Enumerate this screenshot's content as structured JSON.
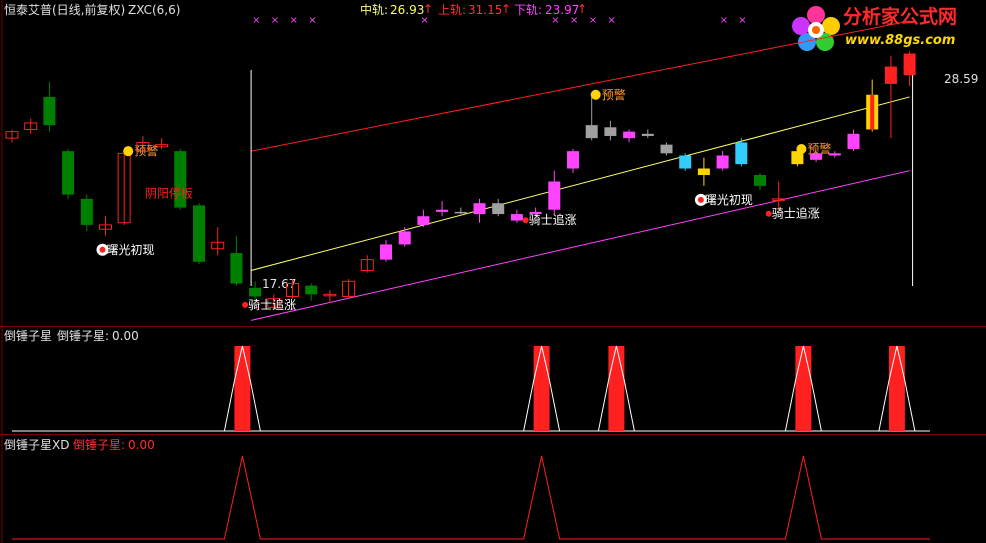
{
  "header": {
    "title": "恒泰艾普(日线,前复权)",
    "indicator": "ZXC(6,6)",
    "mid_label": "中轨:",
    "mid_value": "26.93",
    "upper_label": "上轨:",
    "upper_value": "31.15",
    "lower_label": "下轨:",
    "lower_value": "23.97",
    "arrow": "↑"
  },
  "logo": {
    "name": "分析家公式网",
    "url": "www.88gs.com"
  },
  "colors": {
    "background": "#000000",
    "red": "#ff2020",
    "pink": "#ff44ff",
    "yellow": "#ffff66",
    "green": "#008000",
    "gray": "#a0a0a0",
    "cyan": "#33ccff",
    "gold": "#ffd400",
    "separator": "#7a0000",
    "orange_text": "#ff9933"
  },
  "signals": {
    "warn": "预警",
    "dawn": "曙光初现",
    "knight": "骑士追涨",
    "yinyang": "阴阳停板"
  },
  "price_labels": {
    "high": "28.59",
    "low": "17.67"
  },
  "panel2": {
    "name": "倒锤子星",
    "name2": "倒锤子星:",
    "value": "0.00"
  },
  "panel3": {
    "name": "倒锤子星XD",
    "name2": "倒锤子星:",
    "value": "0.00"
  },
  "chart_data": {
    "type": "candlestick",
    "price_range": [
      17.0,
      30.0
    ],
    "candles": [
      {
        "o": 24.9,
        "c": 24.6,
        "h": 25.0,
        "l": 24.4,
        "color": "red_hollow"
      },
      {
        "o": 25.0,
        "c": 25.3,
        "h": 25.5,
        "l": 24.8,
        "color": "red_hollow"
      },
      {
        "o": 26.5,
        "c": 25.2,
        "h": 27.2,
        "l": 24.9,
        "color": "green"
      },
      {
        "o": 24.0,
        "c": 22.0,
        "h": 24.1,
        "l": 21.8,
        "color": "green"
      },
      {
        "o": 21.8,
        "c": 20.6,
        "h": 22.0,
        "l": 20.3,
        "color": "green"
      },
      {
        "o": 20.6,
        "c": 20.4,
        "h": 21.0,
        "l": 20.1,
        "color": "red_hollow"
      },
      {
        "o": 20.7,
        "c": 23.9,
        "h": 24.0,
        "l": 20.6,
        "color": "red_hollow"
      },
      {
        "o": 24.0,
        "c": 24.4,
        "h": 24.7,
        "l": 23.9,
        "color": "red_hollow"
      },
      {
        "o": 24.2,
        "c": 24.3,
        "h": 24.6,
        "l": 24.1,
        "color": "red_hollow"
      },
      {
        "o": 24.0,
        "c": 21.4,
        "h": 24.1,
        "l": 21.3,
        "color": "green"
      },
      {
        "o": 21.5,
        "c": 18.9,
        "h": 21.6,
        "l": 18.8,
        "color": "green"
      },
      {
        "o": 19.5,
        "c": 19.8,
        "h": 20.5,
        "l": 19.2,
        "color": "red_hollow"
      },
      {
        "o": 19.3,
        "c": 17.9,
        "h": 20.1,
        "l": 17.8,
        "color": "green"
      },
      {
        "o": 17.7,
        "c": 17.3,
        "h": 18.0,
        "l": 17.1,
        "color": "green"
      },
      {
        "o": 16.8,
        "c": 17.2,
        "h": 17.4,
        "l": 16.7,
        "color": "red_hollow"
      },
      {
        "o": 17.3,
        "c": 17.9,
        "h": 18.1,
        "l": 17.2,
        "color": "red_hollow"
      },
      {
        "o": 17.8,
        "c": 17.4,
        "h": 17.9,
        "l": 17.1,
        "color": "green"
      },
      {
        "o": 17.4,
        "c": 17.4,
        "h": 17.6,
        "l": 17.0,
        "color": "red_hollow"
      },
      {
        "o": 17.3,
        "c": 18.0,
        "h": 18.1,
        "l": 17.2,
        "color": "red_hollow"
      },
      {
        "o": 18.5,
        "c": 19.0,
        "h": 19.2,
        "l": 18.4,
        "color": "red_hollow"
      },
      {
        "o": 19.0,
        "c": 19.7,
        "h": 19.9,
        "l": 18.9,
        "color": "pink"
      },
      {
        "o": 19.7,
        "c": 20.3,
        "h": 20.5,
        "l": 19.6,
        "color": "pink"
      },
      {
        "o": 20.6,
        "c": 21.0,
        "h": 21.3,
        "l": 20.5,
        "color": "pink"
      },
      {
        "o": 21.2,
        "c": 21.3,
        "h": 21.7,
        "l": 21.0,
        "color": "pink"
      },
      {
        "o": 21.2,
        "c": 21.2,
        "h": 21.4,
        "l": 21.1,
        "color": "gray"
      },
      {
        "o": 21.1,
        "c": 21.6,
        "h": 21.8,
        "l": 20.7,
        "color": "pink"
      },
      {
        "o": 21.6,
        "c": 21.1,
        "h": 21.8,
        "l": 21.0,
        "color": "gray"
      },
      {
        "o": 20.8,
        "c": 21.1,
        "h": 21.3,
        "l": 20.7,
        "color": "pink"
      },
      {
        "o": 21.1,
        "c": 21.2,
        "h": 21.4,
        "l": 21.0,
        "color": "pink"
      },
      {
        "o": 21.3,
        "c": 22.6,
        "h": 23.1,
        "l": 21.1,
        "color": "pink"
      },
      {
        "o": 23.2,
        "c": 24.0,
        "h": 24.1,
        "l": 23.0,
        "color": "pink"
      },
      {
        "o": 24.6,
        "c": 25.2,
        "h": 26.6,
        "l": 24.5,
        "color": "gray"
      },
      {
        "o": 25.1,
        "c": 24.7,
        "h": 25.4,
        "l": 24.5,
        "color": "gray"
      },
      {
        "o": 24.6,
        "c": 24.9,
        "h": 25.0,
        "l": 24.4,
        "color": "pink"
      },
      {
        "o": 24.7,
        "c": 24.8,
        "h": 25.0,
        "l": 24.6,
        "color": "gray"
      },
      {
        "o": 24.3,
        "c": 23.9,
        "h": 24.4,
        "l": 23.8,
        "color": "gray"
      },
      {
        "o": 23.8,
        "c": 23.2,
        "h": 23.9,
        "l": 23.1,
        "color": "cyan"
      },
      {
        "o": 22.9,
        "c": 23.2,
        "h": 23.7,
        "l": 22.4,
        "color": "gold"
      },
      {
        "o": 23.2,
        "c": 23.8,
        "h": 24.0,
        "l": 23.1,
        "color": "pink"
      },
      {
        "o": 23.4,
        "c": 24.4,
        "h": 24.6,
        "l": 23.3,
        "color": "cyan"
      },
      {
        "o": 22.9,
        "c": 22.4,
        "h": 23.0,
        "l": 22.2,
        "color": "green"
      },
      {
        "o": 21.8,
        "c": 21.8,
        "h": 22.6,
        "l": 21.3,
        "color": "red_hollow"
      },
      {
        "o": 23.4,
        "c": 24.0,
        "h": 24.1,
        "l": 23.3,
        "color": "gold"
      },
      {
        "o": 23.6,
        "c": 23.9,
        "h": 24.0,
        "l": 23.5,
        "color": "pink"
      },
      {
        "o": 23.8,
        "c": 23.9,
        "h": 24.0,
        "l": 23.7,
        "color": "pink"
      },
      {
        "o": 24.1,
        "c": 24.8,
        "h": 25.0,
        "l": 24.0,
        "color": "pink"
      },
      {
        "o": 25.0,
        "c": 26.6,
        "h": 27.3,
        "l": 24.9,
        "color": "gold_red"
      },
      {
        "o": 27.1,
        "c": 27.9,
        "h": 28.4,
        "l": 24.6,
        "color": "red"
      },
      {
        "o": 27.5,
        "c": 28.5,
        "h": 28.6,
        "l": 27.0,
        "color": "red"
      }
    ],
    "channel_start_candle": 13,
    "channel": {
      "upper": [
        24.0,
        30.0
      ],
      "mid": [
        18.5,
        26.5
      ],
      "lower": [
        16.2,
        23.1
      ]
    },
    "signals_on_candles": [
      {
        "candle": 6,
        "label": "预警",
        "kind": "warn"
      },
      {
        "candle": 5,
        "label": "曙光初现",
        "kind": "dawn"
      },
      {
        "candle": 7,
        "label": "阴阳停板",
        "kind": "yinyang"
      },
      {
        "candle": 13,
        "label": "骑士追涨",
        "kind": "knight"
      },
      {
        "candle": 28,
        "label": "骑士追涨",
        "kind": "knight"
      },
      {
        "candle": 31,
        "label": "预警",
        "kind": "warn"
      },
      {
        "candle": 37,
        "label": "曙光初现",
        "kind": "dawn"
      },
      {
        "candle": 41,
        "label": "骑士追涨",
        "kind": "knight"
      },
      {
        "candle": 42,
        "label": "预警",
        "kind": "warn"
      }
    ],
    "top_markers": [
      13,
      14,
      15,
      16,
      22,
      29,
      30,
      31,
      32,
      38,
      39
    ],
    "top_dots": [
      4,
      6,
      24,
      33
    ],
    "signal_panel_hits": [
      12,
      28,
      32,
      42,
      47
    ],
    "signal_panel_xd_hits": [
      12,
      28,
      42
    ]
  }
}
